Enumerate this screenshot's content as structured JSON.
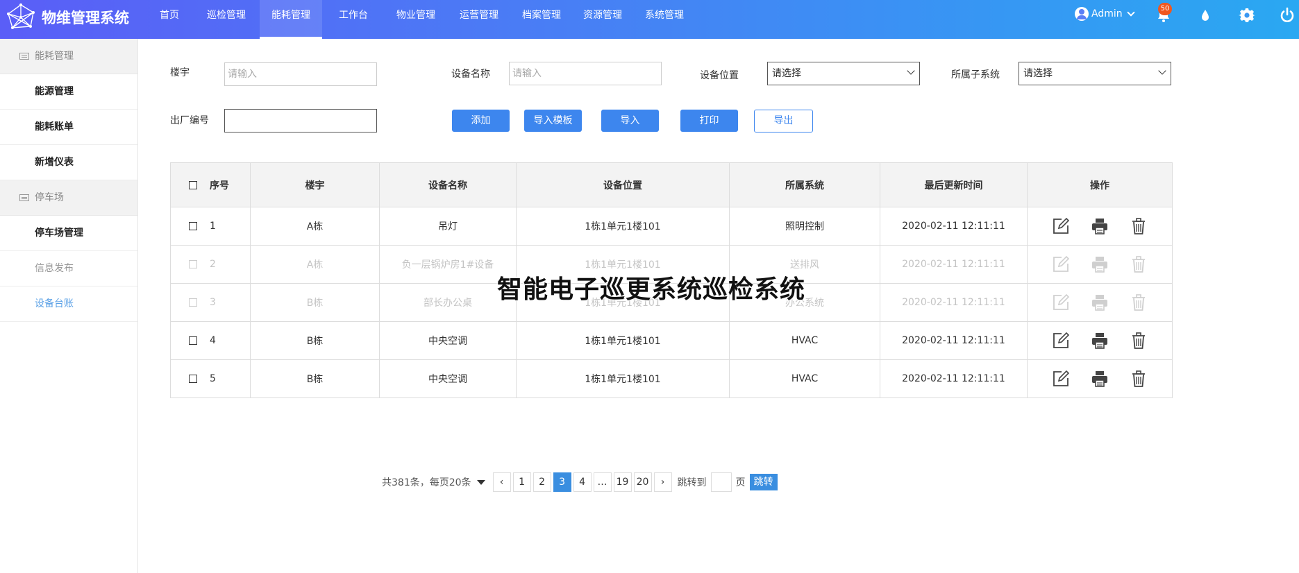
{
  "app": {
    "title": "物维管理系统"
  },
  "nav": [
    {
      "label": "首页",
      "active": false
    },
    {
      "label": "巡检管理",
      "active": false
    },
    {
      "label": "能耗管理",
      "active": true
    },
    {
      "label": "工作台",
      "active": false
    },
    {
      "label": "物业管理",
      "active": false
    },
    {
      "label": "运营管理",
      "active": false
    },
    {
      "label": "档案管理",
      "active": false
    },
    {
      "label": "资源管理",
      "active": false
    },
    {
      "label": "系统管理",
      "active": false
    }
  ],
  "user": {
    "name": "Admin",
    "notifications": "50"
  },
  "sidebar": {
    "group1": "能耗管理",
    "items1": [
      "能源管理",
      "能耗账单",
      "新增仪表"
    ],
    "group2": "停车场",
    "items2": [
      "停车场管理",
      "信息发布",
      "设备台账"
    ]
  },
  "filters": {
    "building_label": "楼宇",
    "building_placeholder": "请输入",
    "device_name_label": "设备名称",
    "device_name_placeholder": "请输入",
    "location_label": "设备位置",
    "location_value": "请选择",
    "subsystem_label": "所属子系统",
    "subsystem_value": "请选择",
    "serial_label": "出厂编号"
  },
  "buttons": {
    "add": "添加",
    "import_template": "导入模板",
    "import": "导入",
    "print": "打印",
    "export": "导出"
  },
  "table": {
    "headers": [
      "序号",
      "楼宇",
      "设备名称",
      "设备位置",
      "所属系统",
      "最后更新时间",
      "操作"
    ],
    "rows": [
      {
        "no": "1",
        "building": "A栋",
        "device": "吊灯",
        "location": "1栋1单元1楼101",
        "system": "照明控制",
        "updated": "2020-02-11 12:11:11"
      },
      {
        "no": "2",
        "building": "A栋",
        "device": "负一层锅炉房1#设备",
        "location": "1栋1单元1楼101",
        "system": "送排风",
        "updated": "2020-02-11 12:11:11"
      },
      {
        "no": "3",
        "building": "B栋",
        "device": "部长办公桌",
        "location": "1栋1单元1楼101",
        "system": "办公系统",
        "updated": "2020-02-11 12:11:11"
      },
      {
        "no": "4",
        "building": "B栋",
        "device": "中央空调",
        "location": "1栋1单元1楼101",
        "system": "HVAC",
        "updated": "2020-02-11 12:11:11"
      },
      {
        "no": "5",
        "building": "B栋",
        "device": "中央空调",
        "location": "1栋1单元1楼101",
        "system": "HVAC",
        "updated": "2020-02-11 12:11:11"
      }
    ]
  },
  "watermark": "智能电子巡更系统巡检系统",
  "pagination": {
    "summary": "共381条，每页20条",
    "prev": "‹",
    "next": "›",
    "pages": [
      "1",
      "2",
      "3",
      "4",
      "…",
      "19",
      "20"
    ],
    "current": "3",
    "jump_label": "跳转到",
    "page_unit": "页",
    "jump_button": "跳转"
  },
  "colors": {
    "accent": "#3d86ee",
    "header_start": "#5a5ef7",
    "header_end": "#2aa8f2",
    "badge": "#f0571f",
    "active_side": "#5aa0e6"
  }
}
